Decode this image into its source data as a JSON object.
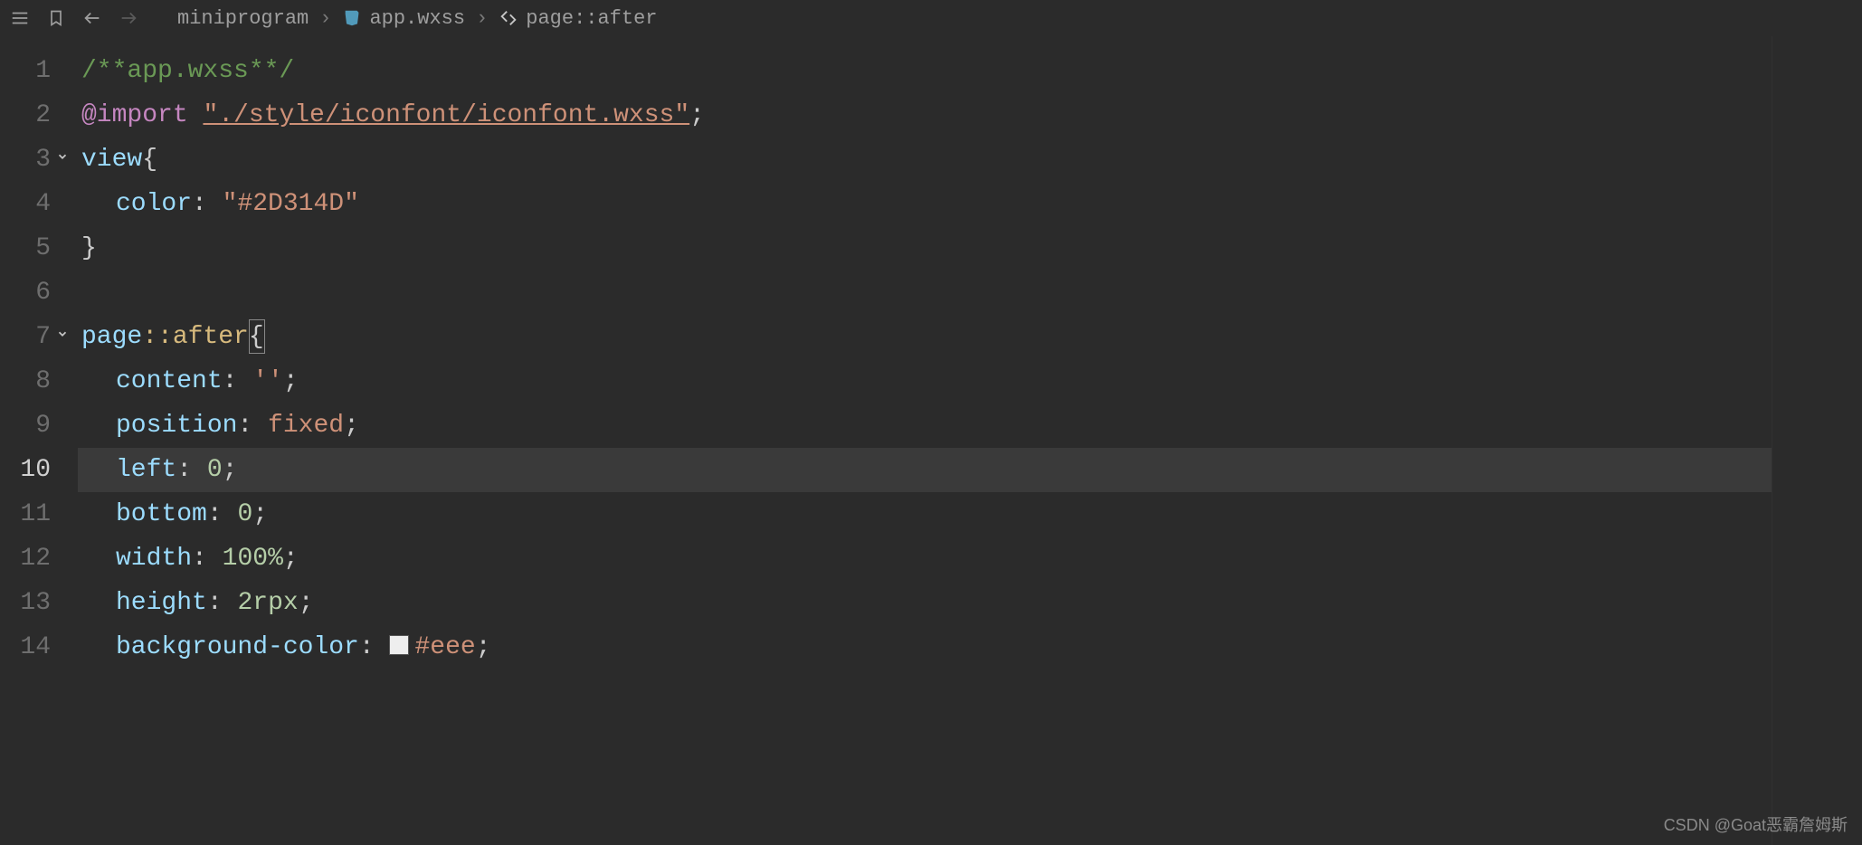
{
  "toolbar": {
    "menu_icon": "menu-icon",
    "bookmark_icon": "bookmark-icon",
    "back_icon": "arrow-left-icon",
    "forward_icon": "arrow-right-icon"
  },
  "breadcrumb": {
    "segments": [
      "miniprogram",
      "app.wxss",
      "page::after"
    ],
    "file_icon": "css-file-icon",
    "symbol_icon": "selector-icon"
  },
  "editor": {
    "active_line": 10,
    "lines": [
      {
        "n": 1,
        "kind": "comment",
        "text": "/**app.wxss**/"
      },
      {
        "n": 2,
        "kind": "import",
        "keyword": "@import",
        "path": "\"./style/iconfont/iconfont.wxss\"",
        "tail": ";"
      },
      {
        "n": 3,
        "kind": "selStart",
        "selector": "view",
        "brace": "{",
        "fold": true
      },
      {
        "n": 4,
        "kind": "decl",
        "prop": "color",
        "value": "\"#2D314D\"",
        "isString": true
      },
      {
        "n": 5,
        "kind": "brace",
        "brace": "}"
      },
      {
        "n": 6,
        "kind": "blank"
      },
      {
        "n": 7,
        "kind": "selStart",
        "selector": "page",
        "pseudo": "::after",
        "brace": "{",
        "fold": true,
        "caretBox": true
      },
      {
        "n": 8,
        "kind": "decl",
        "prop": "content",
        "value": "''",
        "isString": true,
        "semi": ";"
      },
      {
        "n": 9,
        "kind": "decl",
        "prop": "position",
        "value": "fixed",
        "semi": ";"
      },
      {
        "n": 10,
        "kind": "decl",
        "prop": "left",
        "value": "0",
        "isNum": true,
        "semi": ";"
      },
      {
        "n": 11,
        "kind": "decl",
        "prop": "bottom",
        "value": "0",
        "isNum": true,
        "semi": ";"
      },
      {
        "n": 12,
        "kind": "decl",
        "prop": "width",
        "value": "100",
        "unit": "%",
        "isNum": true,
        "semi": ";"
      },
      {
        "n": 13,
        "kind": "decl",
        "prop": "height",
        "value": "2",
        "unit": "rpx",
        "isNum": true,
        "semi": ";"
      },
      {
        "n": 14,
        "kind": "decl",
        "prop": "background-color",
        "swatch": "#eee",
        "value": "#eee",
        "isColor": true,
        "semi": ";"
      }
    ]
  },
  "watermark": "CSDN @Goat恶霸詹姆斯"
}
